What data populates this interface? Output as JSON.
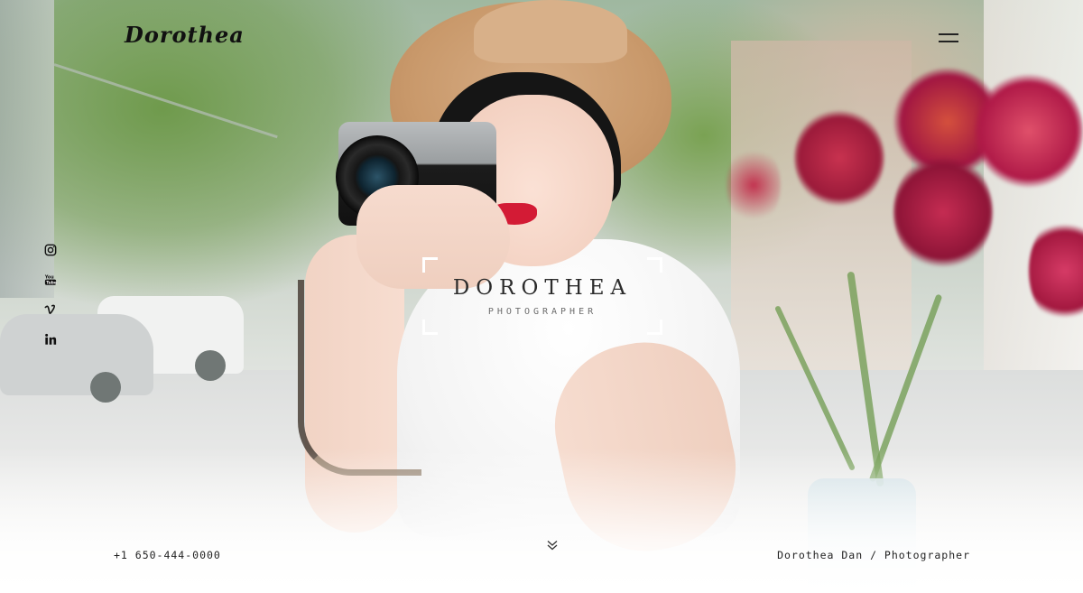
{
  "header": {
    "logo_text": "Dorothea",
    "menu_icon": "hamburger-menu-icon"
  },
  "social": {
    "items": [
      {
        "name": "instagram",
        "icon": "instagram-icon"
      },
      {
        "name": "youtube",
        "icon": "youtube-icon"
      },
      {
        "name": "vimeo",
        "icon": "vimeo-icon"
      },
      {
        "name": "linkedin",
        "icon": "linkedin-icon"
      }
    ]
  },
  "hero": {
    "title": "DOROTHEA",
    "subtitle": "PHOTOGRAPHER",
    "frame_color": "#ffffff"
  },
  "footer": {
    "phone": "+1 650-444-0000",
    "credit": "Dorothea Dan / Photographer",
    "scroll_icon": "double-chevron-down-icon"
  }
}
